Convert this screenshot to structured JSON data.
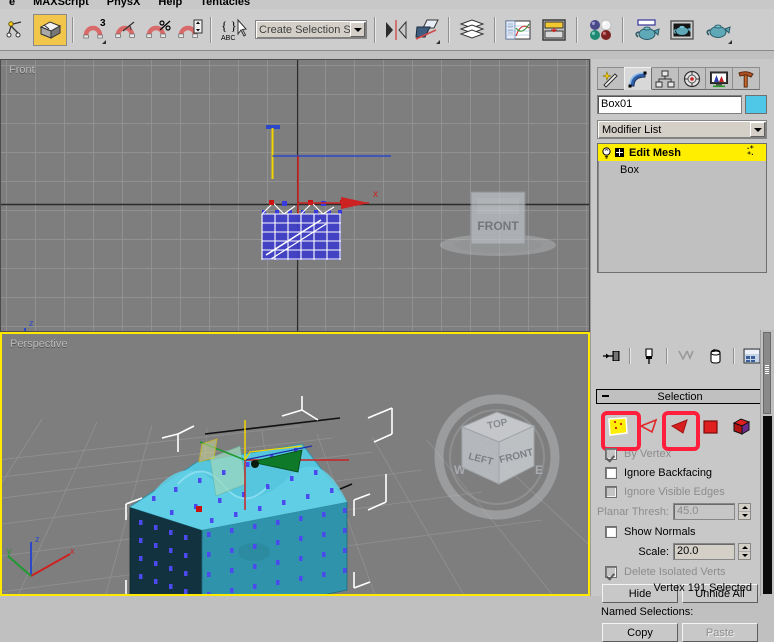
{
  "menu": {
    "items": [
      "e",
      "MAXScript",
      "PhysX",
      "Help",
      "Tentacles"
    ]
  },
  "toolbar": {
    "buttons": [
      {
        "name": "select-and-link",
        "icon": "link-icon",
        "active": false
      },
      {
        "name": "bind-to-space-warp",
        "icon": "box-cube-icon",
        "active": true
      },
      {
        "name": "snaps-toggle",
        "icon": "magnet-3-icon",
        "active": false
      },
      {
        "name": "angle-snap-toggle",
        "icon": "magnet-angle-icon",
        "active": false
      },
      {
        "name": "percent-snap-toggle",
        "icon": "magnet-percent-icon",
        "active": false
      },
      {
        "name": "spinner-snap-toggle",
        "icon": "magnet-spinner-icon",
        "active": false
      },
      {
        "name": "named-selection-sets",
        "icon": "braces-abc-icon",
        "active": false
      },
      {
        "name": "mirror",
        "icon": "mirror-icon",
        "active": false
      },
      {
        "name": "align",
        "icon": "align-icon",
        "active": false
      },
      {
        "name": "layer-manager",
        "icon": "layers-icon",
        "active": false
      },
      {
        "name": "curve-editor",
        "icon": "curve-editor-icon",
        "active": false
      },
      {
        "name": "schematic-view",
        "icon": "schematic-view-icon",
        "active": false
      },
      {
        "name": "material-editor",
        "icon": "material-spheres-icon",
        "active": false
      },
      {
        "name": "render-setup",
        "icon": "render-teapot-icon",
        "active": false
      },
      {
        "name": "rendered-frame-window",
        "icon": "rendered-frame-icon",
        "active": false
      },
      {
        "name": "render-production",
        "icon": "teapot-icon",
        "active": false
      }
    ],
    "selection_set": {
      "value": "Create Selection Set",
      "placeholder": "Create Selection Set"
    }
  },
  "viewports": [
    {
      "name": "front",
      "label": "Front",
      "active": false,
      "viewcube": [
        "FRONT"
      ]
    },
    {
      "name": "perspective",
      "label": "Perspective",
      "active": true,
      "viewcube": [
        "TOP",
        "LEFT",
        "FRONT"
      ]
    }
  ],
  "command_panel": {
    "tabs": [
      {
        "name": "create",
        "icon": "wand-star-icon",
        "active": false
      },
      {
        "name": "modify",
        "icon": "curve-arc-icon",
        "active": true
      },
      {
        "name": "hierarchy",
        "icon": "hierarchy-tree-icon",
        "active": false
      },
      {
        "name": "motion",
        "icon": "motion-wheel-icon",
        "active": false
      },
      {
        "name": "display",
        "icon": "display-monitor-icon",
        "active": false
      },
      {
        "name": "utilities",
        "icon": "hammer-icon",
        "active": false
      }
    ],
    "object_name": "Box01",
    "object_color": "#4fc8e8",
    "modifier_list_label": "Modifier List",
    "stack": [
      {
        "label": "Edit Mesh",
        "selected": true,
        "has_lightbulb": true,
        "has_expand": true
      },
      {
        "label": "Box",
        "selected": false,
        "has_lightbulb": false,
        "has_expand": false
      }
    ],
    "stack_buttons": [
      {
        "name": "pin-stack",
        "icon": "pin-stack-icon"
      },
      {
        "name": "show-end-result",
        "icon": "show-end-result-icon"
      },
      {
        "name": "make-unique",
        "icon": "make-unique-icon"
      },
      {
        "name": "remove-modifier",
        "icon": "trash-bin-icon"
      },
      {
        "name": "configure-modifier-sets",
        "icon": "configure-sets-icon"
      }
    ]
  },
  "selection_rollout": {
    "title": "Selection",
    "sub_objects": [
      {
        "name": "vertex",
        "icon": "vertex-icon",
        "active": true,
        "annotated": true
      },
      {
        "name": "edge",
        "icon": "edge-icon",
        "active": false,
        "annotated": false
      },
      {
        "name": "face",
        "icon": "face-icon",
        "active": false,
        "annotated": true
      },
      {
        "name": "polygon",
        "icon": "polygon-icon",
        "active": false,
        "annotated": false
      },
      {
        "name": "element",
        "icon": "element-icon",
        "active": false,
        "annotated": false
      }
    ],
    "checkboxes": [
      {
        "name": "by-vertex",
        "label": "By Vertex",
        "checked": true,
        "enabled": false
      },
      {
        "name": "ignore-backfacing",
        "label": "Ignore Backfacing",
        "checked": false,
        "enabled": true
      },
      {
        "name": "ignore-visible-edges",
        "label": "Ignore Visible Edges",
        "checked": false,
        "enabled": false
      }
    ],
    "planar_thresh": {
      "label": "Planar Thresh:",
      "value": "45.0",
      "enabled": false
    },
    "show_normals": {
      "label": "Show Normals",
      "checked": false,
      "enabled": true
    },
    "scale": {
      "label": "Scale:",
      "value": "20.0",
      "enabled": true
    },
    "delete_isolated_verts": {
      "label": "Delete Isolated Verts",
      "checked": true,
      "enabled": false
    },
    "hide_button": "Hide",
    "unhide_all_button": "Unhide All",
    "named_selections_label": "Named Selections:",
    "copy_button": "Copy",
    "paste_button": "Paste",
    "paste_enabled": false,
    "status": "Vertex 191 Selected"
  },
  "colors": {
    "viewport_bg": "#7e7e7e",
    "active_border": "#ffe900",
    "stack_highlight": "#ffee00",
    "annotation": "#ff1f3d",
    "toolbar_active": "#f2c64a",
    "panel_bg": "#c8c8c8",
    "mesh_cyan": "#4fc8e8",
    "vertex_blue": "#4040ff"
  }
}
